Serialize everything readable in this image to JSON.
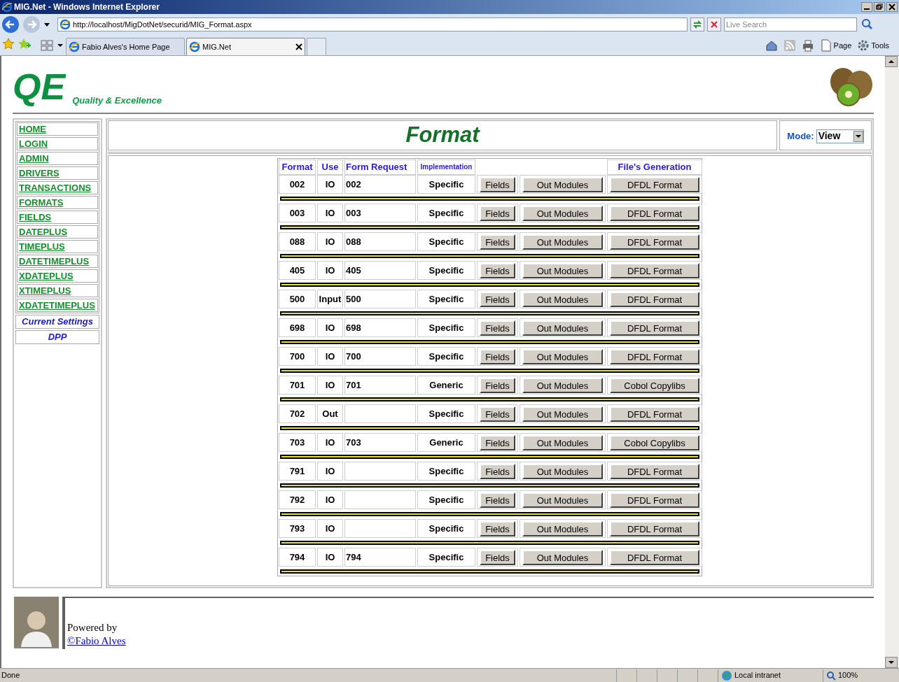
{
  "browser": {
    "title": "MIG.Net - Windows Internet Explorer",
    "address": "http://localhost/MigDotNet/securid/MIG_Format.aspx",
    "search_placeholder": "Live Search",
    "tabs": [
      {
        "label": "Fabio Alves's Home Page",
        "selected": false
      },
      {
        "label": "MIG.Net",
        "selected": true
      }
    ],
    "tools": [
      "Page",
      "Tools"
    ]
  },
  "header": {
    "logo": "QE",
    "tagline": "Quality & Excellence"
  },
  "nav": {
    "items": [
      "HOME",
      "LOGIN",
      "ADMIN",
      "DRIVERS",
      "TRANSACTIONS",
      "FORMATS",
      "FIELDS",
      "DATEPLUS",
      "TIMEPLUS",
      "DATETIMEPLUS",
      "XDATEPLUS",
      "XTIMEPLUS",
      "XDATETIMEPLUS"
    ],
    "extra_links": [
      "Current Settings",
      "DPP"
    ]
  },
  "page_title": "Format",
  "mode": {
    "label": "Mode:",
    "value": "View"
  },
  "table": {
    "headers": {
      "format": "Format",
      "use": "Use",
      "form_request": "Form Request",
      "implementation": "Implementation",
      "files_generation": "File's Generation"
    },
    "rows": [
      {
        "format": "002",
        "use": "IO",
        "form_request": "002",
        "implementation": "Specific",
        "fields_button": "Fields",
        "modules_button": "Out Modules",
        "generation_button": "DFDL Format"
      },
      {
        "format": "003",
        "use": "IO",
        "form_request": "003",
        "implementation": "Specific",
        "fields_button": "Fields",
        "modules_button": "Out Modules",
        "generation_button": "DFDL Format"
      },
      {
        "format": "088",
        "use": "IO",
        "form_request": "088",
        "implementation": "Specific",
        "fields_button": "Fields",
        "modules_button": "Out Modules",
        "generation_button": "DFDL Format"
      },
      {
        "format": "405",
        "use": "IO",
        "form_request": "405",
        "implementation": "Specific",
        "fields_button": "Fields",
        "modules_button": "Out Modules",
        "generation_button": "DFDL Format"
      },
      {
        "format": "500",
        "use": "Input",
        "form_request": "500",
        "implementation": "Specific",
        "fields_button": "Fields",
        "modules_button": "Out Modules",
        "generation_button": "DFDL Format"
      },
      {
        "format": "698",
        "use": "IO",
        "form_request": "698",
        "implementation": "Specific",
        "fields_button": "Fields",
        "modules_button": "Out Modules",
        "generation_button": "DFDL Format"
      },
      {
        "format": "700",
        "use": "IO",
        "form_request": "700",
        "implementation": "Specific",
        "fields_button": "Fields",
        "modules_button": "Out Modules",
        "generation_button": "DFDL Format"
      },
      {
        "format": "701",
        "use": "IO",
        "form_request": "701",
        "implementation": "Generic",
        "fields_button": "Fields",
        "modules_button": "Out Modules",
        "generation_button": "Cobol Copylibs"
      },
      {
        "format": "702",
        "use": "Out",
        "implementation": "Specific",
        "fields_button": "Fields",
        "modules_button": "Out Modules",
        "generation_button": "DFDL Format"
      },
      {
        "format": "703",
        "use": "IO",
        "form_request": "703",
        "implementation": "Generic",
        "fields_button": "Fields",
        "modules_button": "Out Modules",
        "generation_button": "Cobol Copylibs"
      },
      {
        "format": "791",
        "use": "IO",
        "implementation": "Specific",
        "fields_button": "Fields",
        "modules_button": "Out Modules",
        "generation_button": "DFDL Format"
      },
      {
        "format": "792",
        "use": "IO",
        "implementation": "Specific",
        "fields_button": "Fields",
        "modules_button": "Out Modules",
        "generation_button": "DFDL Format"
      },
      {
        "format": "793",
        "use": "IO",
        "implementation": "Specific",
        "fields_button": "Fields",
        "modules_button": "Out Modules",
        "generation_button": "DFDL Format"
      },
      {
        "format": "794",
        "use": "IO",
        "form_request": "794",
        "implementation": "Specific",
        "fields_button": "Fields",
        "modules_button": "Out Modules",
        "generation_button": "DFDL Format"
      }
    ]
  },
  "footer": {
    "powered_by": "Powered by",
    "link": "©Fabio Alves"
  },
  "status_bar": {
    "text": "Done",
    "zone": "Local intranet",
    "zoom": "100%"
  }
}
